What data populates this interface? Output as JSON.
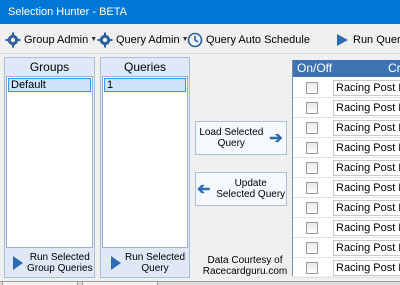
{
  "window": {
    "title": "Selection Hunter - BETA"
  },
  "toolbar": {
    "group_admin": "Group Admin",
    "query_admin": "Query Admin",
    "query_schedule": "Query Auto Schedule",
    "run_query": "Run Query"
  },
  "groups_panel": {
    "title": "Groups",
    "items": [
      "Default"
    ],
    "run_label_line1": "Run Selected",
    "run_label_line2": "Group Queries"
  },
  "queries_panel": {
    "title": "Queries",
    "items": [
      "1"
    ],
    "run_label_line1": "Run Selected",
    "run_label_line2": "Query"
  },
  "actions": {
    "load_line1": "Load Selected",
    "load_line2": "Query",
    "update_line1": "Update",
    "update_line2": "Selected Query"
  },
  "credit": {
    "line1": "Data Courtesy of",
    "line2": "Racecardguru.com"
  },
  "grid": {
    "col_onoff": "On/Off",
    "col_criteria": "Cr",
    "rows": [
      "Racing Post Ra",
      "Racing Post Ra",
      "Racing Post Ra",
      "Racing Post Ra",
      "Racing Post Ra",
      "Racing Post Ra",
      "Racing Post Ra",
      "Racing Post Ra",
      "Racing Post Ra",
      "Racing Post Ra"
    ]
  },
  "colors": {
    "accent": "#0078d7",
    "header": "#3d73b3",
    "panel": "#dfe8f7",
    "selection": "#cde3fb"
  },
  "icons": [
    "gear-icon",
    "chevron-down-icon",
    "clock-icon",
    "play-icon",
    "arrow-right-icon",
    "arrow-left-icon"
  ]
}
